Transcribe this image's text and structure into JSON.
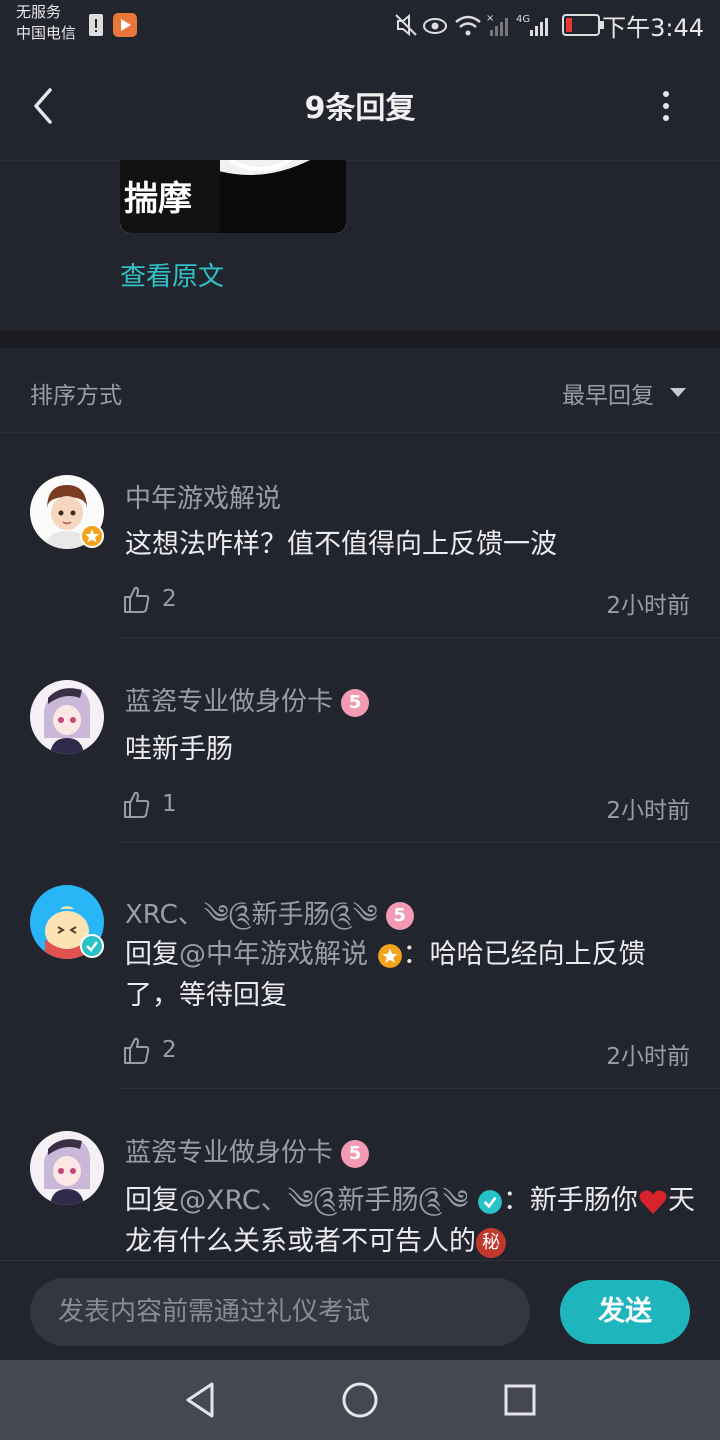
{
  "status_bar": {
    "carrier_line1": "无服务",
    "carrier_line2": "中国电信",
    "network": "4G",
    "time": "下午3:44"
  },
  "nav": {
    "title": "9条回复"
  },
  "post": {
    "thumbnail_text": "揣摩",
    "view_original": "查看原文"
  },
  "sort": {
    "label": "排序方式",
    "value": "最早回复"
  },
  "comments": [
    {
      "name": "中年游戏解说",
      "text": "这想法咋样？值不值得向上反馈一波",
      "likes": "2",
      "time": "2小时前"
    },
    {
      "name": "蓝瓷专业做身份卡",
      "level": "5",
      "text": "哇新手肠",
      "likes": "1",
      "time": "2小时前"
    },
    {
      "name": "XRC、༄༊新手肠༊༄",
      "level": "5",
      "reply_prefix": "回复",
      "reply_to": "@中年游戏解说",
      "text": "：哈哈已经向上反馈了，等待回复",
      "likes": "2",
      "time": "2小时前"
    },
    {
      "name": "蓝瓷专业做身份卡",
      "level": "5",
      "reply_prefix": "回复",
      "reply_to": "@XRC、༄༊新手肠༊༄",
      "text_a": "：新手肠你",
      "text_b": "天龙有什么关系或者不可告人的",
      "secret_badge": "秘"
    }
  ],
  "input": {
    "placeholder": "发表内容前需通过礼仪考试",
    "send_label": "发送"
  },
  "colors": {
    "accent": "#1fb5bd",
    "link": "#2fc3c7",
    "background": "#23252e"
  }
}
